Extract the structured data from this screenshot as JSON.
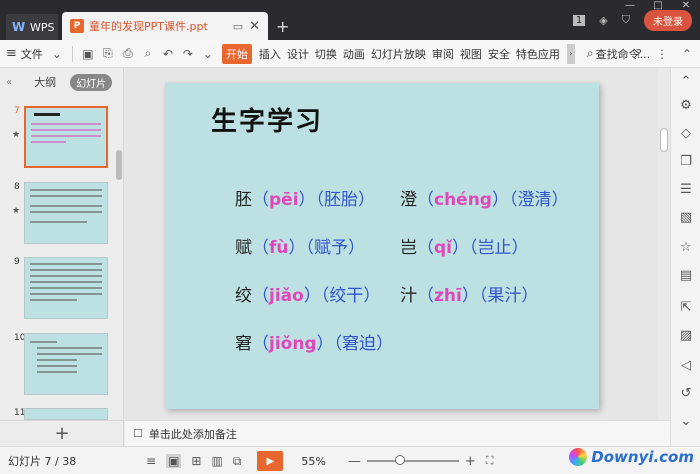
{
  "titlebar": {
    "app_tab": "WPS",
    "doc_tab": "童年的发现PPT课件.ppt",
    "add_tab": "+",
    "count_badge": "1",
    "login": "未登录"
  },
  "menubar": {
    "file": "文件",
    "start": "开始",
    "items": [
      "插入",
      "设计",
      "切换",
      "动画",
      "幻灯片放映",
      "审阅",
      "视图",
      "安全",
      "特色应用"
    ],
    "search": "查找命令..."
  },
  "left_panel": {
    "tab_outline": "大纲",
    "tab_slides": "幻灯片",
    "slides": [
      {
        "num": "7",
        "starred": true,
        "active": true
      },
      {
        "num": "8",
        "starred": true,
        "active": false
      },
      {
        "num": "9",
        "starred": false,
        "active": false
      },
      {
        "num": "10",
        "starred": false,
        "active": false
      },
      {
        "num": "11",
        "starred": false,
        "active": false
      }
    ],
    "add_slide": "+"
  },
  "slide": {
    "title": "生字学习",
    "vocab": [
      {
        "char": "胚",
        "pinyin": "pēi",
        "word": "胚胎"
      },
      {
        "char": "澄",
        "pinyin": "chéng",
        "word": "澄清"
      },
      {
        "char": "赋",
        "pinyin": "fù",
        "word": "赋予"
      },
      {
        "char": "岂",
        "pinyin": "qǐ",
        "word": "岂止"
      },
      {
        "char": "绞",
        "pinyin": "jiǎo",
        "word": "绞干"
      },
      {
        "char": "汁",
        "pinyin": "zhī",
        "word": "果汁"
      },
      {
        "char": "窘",
        "pinyin": "jiǒng",
        "word": "窘迫"
      }
    ]
  },
  "notes": {
    "placeholder": "单击此处添加备注"
  },
  "status": {
    "slide_count": "幻灯片 7 / 38",
    "zoom": "55%",
    "zoom_fraction": 0.35
  },
  "watermark": {
    "text": "Downyi.com"
  }
}
